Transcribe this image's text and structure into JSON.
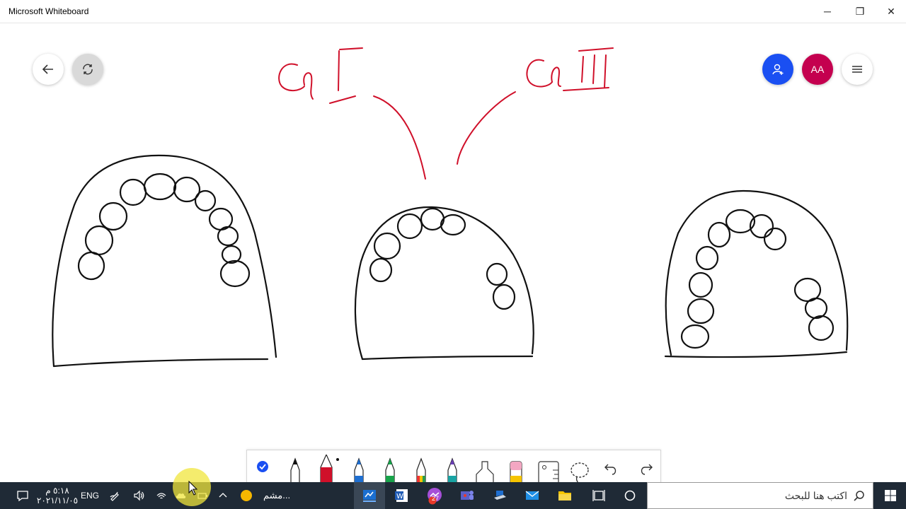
{
  "window": {
    "title": "Microsoft Whiteboard",
    "minimize_glyph": "─",
    "restore_glyph": "❐",
    "close_glyph": "✕"
  },
  "canvas": {
    "ink_red": "#d0102a",
    "ink_black": "#111111",
    "annotations": [
      "Cl I",
      "Cl III"
    ]
  },
  "top_buttons": {
    "back": "arrow-left-icon",
    "sync": "sync-icon",
    "invite": "add-person-icon",
    "avatar_initials": "AA",
    "menu": "hamburger-icon"
  },
  "ink_toolbar": {
    "tools": [
      "select-icon",
      "pen-black",
      "pen-red",
      "pen-blue",
      "pen-green",
      "pen-rainbow",
      "pen-teal",
      "highlighter-icon",
      "eraser-icon",
      "ruler-icon",
      "lasso-icon",
      "undo-icon",
      "redo-icon"
    ]
  },
  "taskbar": {
    "time": "٥:١٨ م",
    "date": "٢٠٢١/١١/٠٥",
    "language": "ENG",
    "running_app_label": "مشم...",
    "search_placeholder": "اكتب هنا للبحث",
    "badge_count": "27",
    "colors": {
      "bg": "#1f2a36",
      "accent": "#1a4ff2"
    }
  }
}
